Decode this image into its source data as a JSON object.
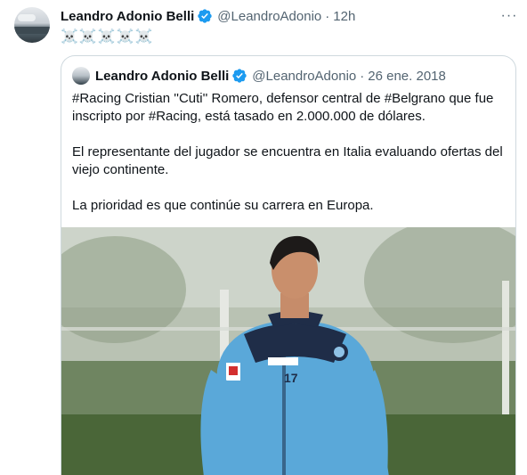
{
  "tweet": {
    "author_name": "Leandro Adonio Belli",
    "handle": "@LeandroAdonio",
    "separator": "·",
    "time": "12h",
    "text": "☠️☠️☠️☠️☠️",
    "more_icon": "more-icon"
  },
  "quote": {
    "author_name": "Leandro Adonio Belli",
    "handle": "@LeandroAdonio",
    "separator": "·",
    "date": "26 ene. 2018",
    "paragraphs": [
      "#Racing Cristian ''Cuti'' Romero, defensor central de #Belgrano que fue inscripto por #Racing, está tasado en 2.000.000 de dólares.",
      "El representante del jugador se encuentra en Italia evaluando ofertas del viejo continente.",
      "La prioridad es que continúe su carrera en Europa."
    ],
    "photo": {
      "jersey_number": "17"
    }
  },
  "colors": {
    "text": "#0f1419",
    "secondary": "#536471",
    "verified": "#1d9bf0",
    "border": "#cfd9de",
    "jersey": "#5aa8d9",
    "jersey_dark": "#1f2d48"
  }
}
